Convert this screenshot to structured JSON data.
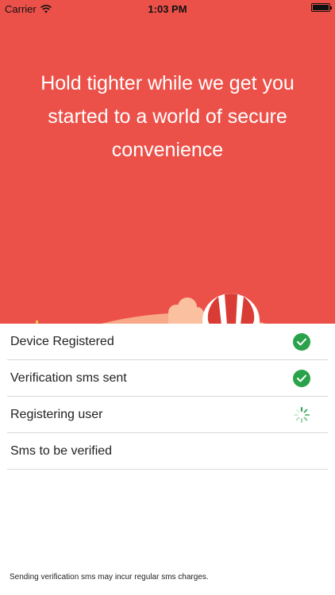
{
  "status_bar": {
    "carrier": "Carrier",
    "time": "1:03 PM",
    "icons": [
      "wifi-icon",
      "battery-icon"
    ]
  },
  "hero": {
    "title": "Hold tighter while we get you started to a world of secure convenience",
    "background_color": "#ec5149"
  },
  "steps": [
    {
      "label": "Device Registered",
      "status": "done",
      "icon": "check-circle-icon"
    },
    {
      "label": "Verification sms sent",
      "status": "done",
      "icon": "check-circle-icon"
    },
    {
      "label": "Registering user",
      "status": "loading",
      "icon": "spinner-icon"
    },
    {
      "label": "Sms to be verified",
      "status": "pending",
      "icon": ""
    }
  ],
  "colors": {
    "success": "#2aa24a",
    "accent": "#ec5149"
  },
  "footer": {
    "note": "Sending verification sms may incur regular sms charges."
  }
}
